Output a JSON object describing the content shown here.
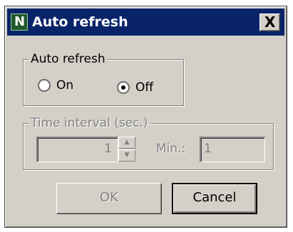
{
  "window": {
    "title": "Auto refresh",
    "app_icon_letter": "N",
    "close_glyph": "X"
  },
  "auto_refresh_group": {
    "legend": "Auto refresh",
    "options": [
      {
        "label": "On",
        "selected": false
      },
      {
        "label": "Off",
        "selected": true
      }
    ]
  },
  "interval_group": {
    "legend": "Time interval (sec.)",
    "interval_value": "1",
    "min_label": "Min.:",
    "min_value": "1"
  },
  "buttons": {
    "ok_label": "OK",
    "cancel_label": "Cancel"
  }
}
